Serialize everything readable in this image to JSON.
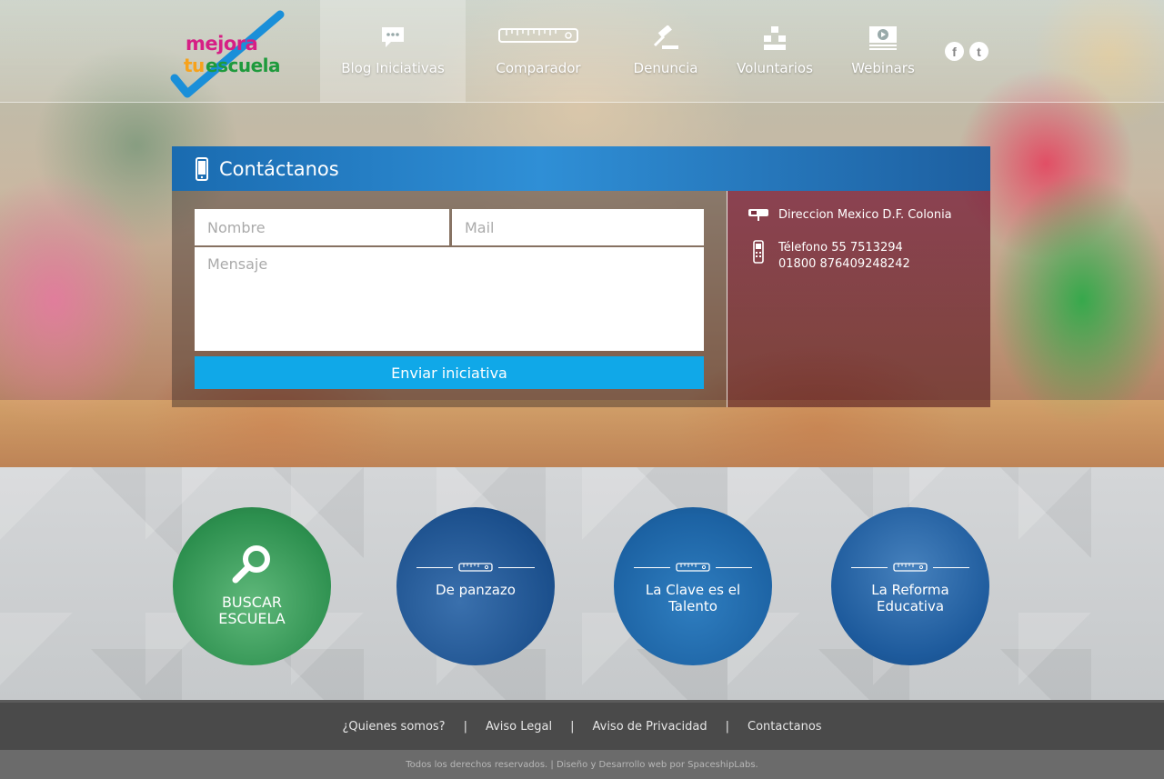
{
  "brand": {
    "logo_word1": "mejora",
    "logo_word2a": "tu",
    "logo_word2b": "escuela",
    "colors": {
      "pink": "#d61f85",
      "orange": "#f7a21b",
      "green": "#1e9a3c",
      "blue": "#1a8fd9"
    }
  },
  "nav": {
    "items": [
      {
        "label": "Blog Iniciativas",
        "icon": "speech-bubble-icon",
        "active": true
      },
      {
        "label": "Comparador",
        "icon": "ruler-icon",
        "active": false
      },
      {
        "label": "Denuncia",
        "icon": "gavel-icon",
        "active": false
      },
      {
        "label": "Voluntarios",
        "icon": "people-icon",
        "active": false
      },
      {
        "label": "Webinars",
        "icon": "video-icon",
        "active": false
      }
    ],
    "social": [
      {
        "name": "facebook-icon",
        "glyph": "f"
      },
      {
        "name": "twitter-icon",
        "glyph": "t"
      }
    ]
  },
  "contact": {
    "title": "Contáctanos",
    "form": {
      "name_placeholder": "Nombre",
      "mail_placeholder": "Mail",
      "message_placeholder": "Mensaje",
      "submit_label": "Enviar iniciativa"
    },
    "info": {
      "address": "Direccion Mexico D.F. Colonia",
      "phone1": "Télefono 55 7513294",
      "phone2": "01800 876409248242"
    }
  },
  "features": [
    {
      "title_line1": "BUSCAR",
      "title_line2": "ESCUELA",
      "icon": "magnifier-icon"
    },
    {
      "title_line1": "De panzazo",
      "title_line2": "",
      "icon": "ruler-icon"
    },
    {
      "title_line1": "La Clave es el",
      "title_line2": "Talento",
      "icon": "ruler-icon"
    },
    {
      "title_line1": "La Reforma",
      "title_line2": "Educativa",
      "icon": "ruler-icon"
    }
  ],
  "footer": {
    "links": [
      "¿Quienes somos?",
      "Aviso Legal",
      "Aviso de Privacidad",
      "Contactanos"
    ],
    "separator": "|",
    "copyright": "Todos los derechos reservados. | Diseño y Desarrollo web por SpaceshipLabs."
  }
}
